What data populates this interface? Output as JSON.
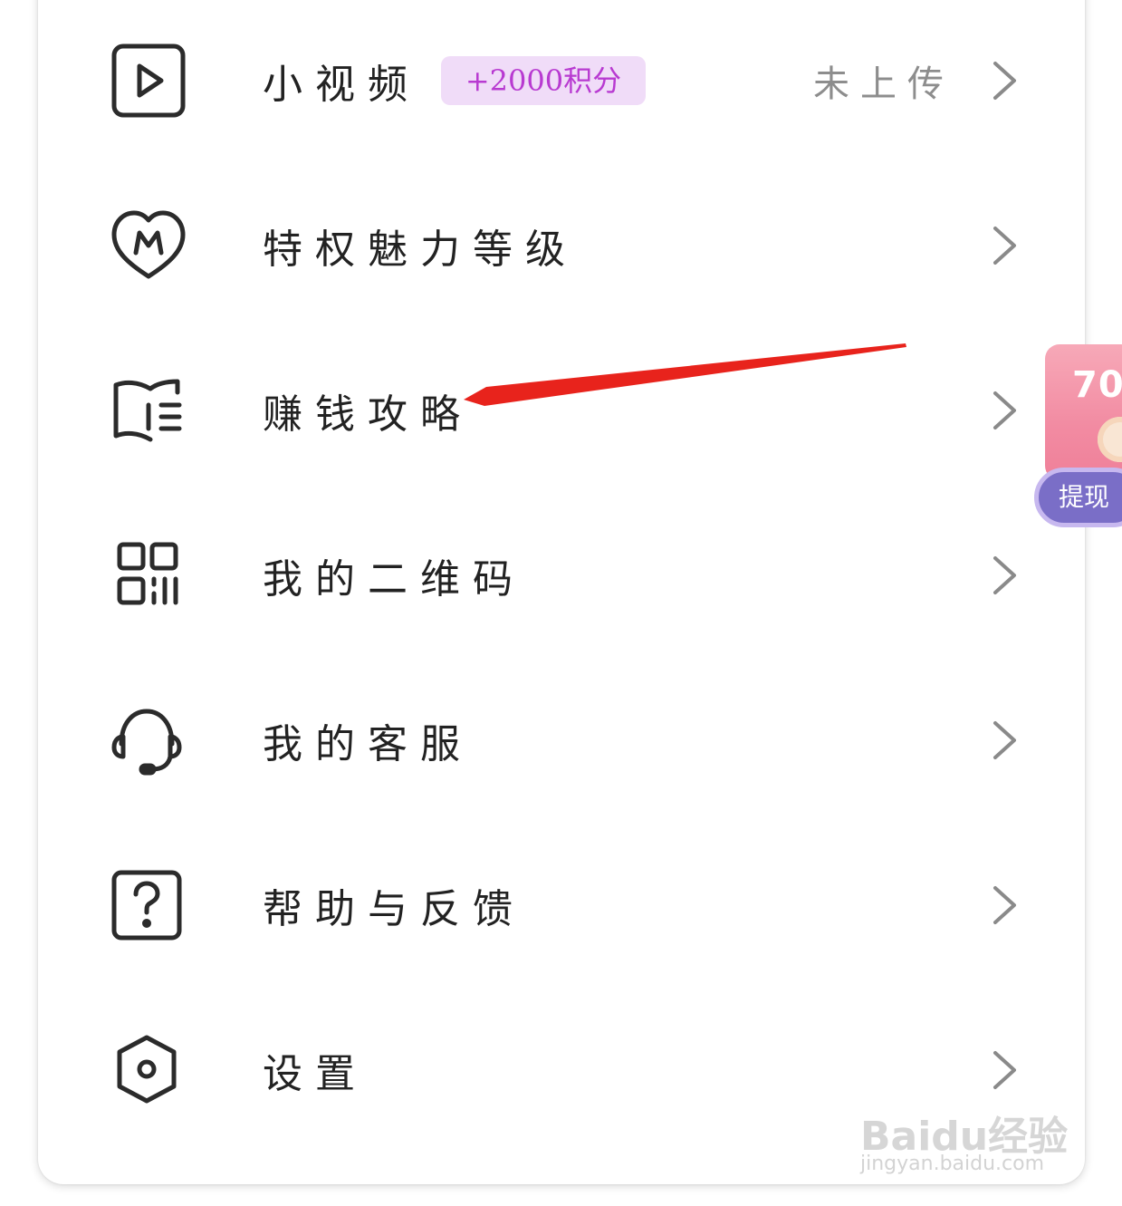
{
  "menu": {
    "items": [
      {
        "label": "小视频",
        "badge": "+2000积分",
        "status": "未上传",
        "icon": "play-video-icon"
      },
      {
        "label": "特权魅力等级",
        "icon": "heart-level-icon"
      },
      {
        "label": "赚钱攻略",
        "icon": "guide-book-icon"
      },
      {
        "label": "我的二维码",
        "icon": "qr-code-icon"
      },
      {
        "label": "我的客服",
        "icon": "headset-icon"
      },
      {
        "label": "帮助与反馈",
        "icon": "help-question-icon"
      },
      {
        "label": "设置",
        "icon": "settings-hexagon-icon"
      }
    ]
  },
  "floating_widget": {
    "amount": "70",
    "button_label": "提现"
  },
  "watermark": {
    "brand": "Baidu经验",
    "url": "jingyan.baidu.com"
  },
  "colors": {
    "text": "#222222",
    "status_text": "#8d8d8d",
    "badge_bg": "#f0dcf8",
    "badge_text": "#b83ad1",
    "chevron": "#8a8a8a",
    "arrow_annotation": "#e8231c",
    "widget_pink": "#f28ba2",
    "widget_purple": "#7a6ec7"
  }
}
